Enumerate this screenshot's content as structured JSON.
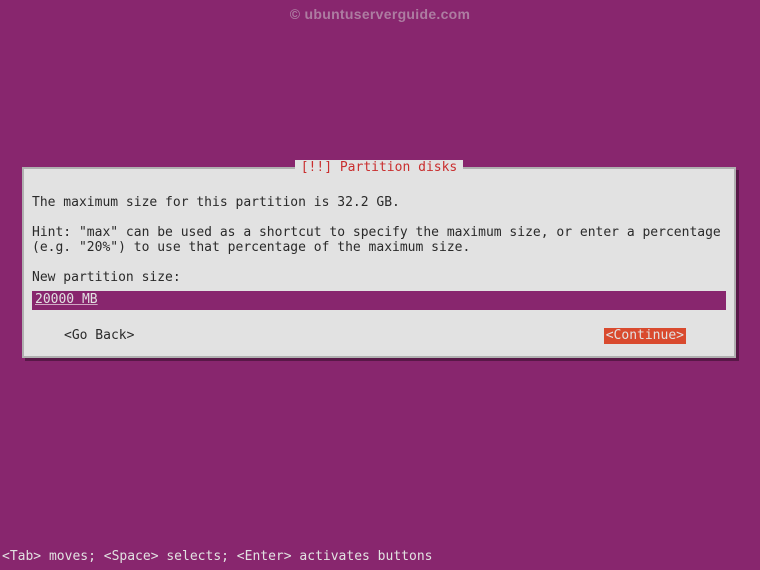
{
  "watermark": "© ubuntuserverguide.com",
  "dialog": {
    "title": "[!!] Partition disks",
    "max_size_text": "The maximum size for this partition is 32.2 GB.",
    "hint_text": "Hint: \"max\" can be used as a shortcut to specify the maximum size, or enter a percentage (e.g. \"20%\") to use that percentage of the maximum size.",
    "prompt_label": "New partition size:",
    "input_value": "20000 MB",
    "go_back_label": "<Go Back>",
    "continue_label": "<Continue>"
  },
  "statusbar": "<Tab> moves; <Space> selects; <Enter> activates buttons"
}
